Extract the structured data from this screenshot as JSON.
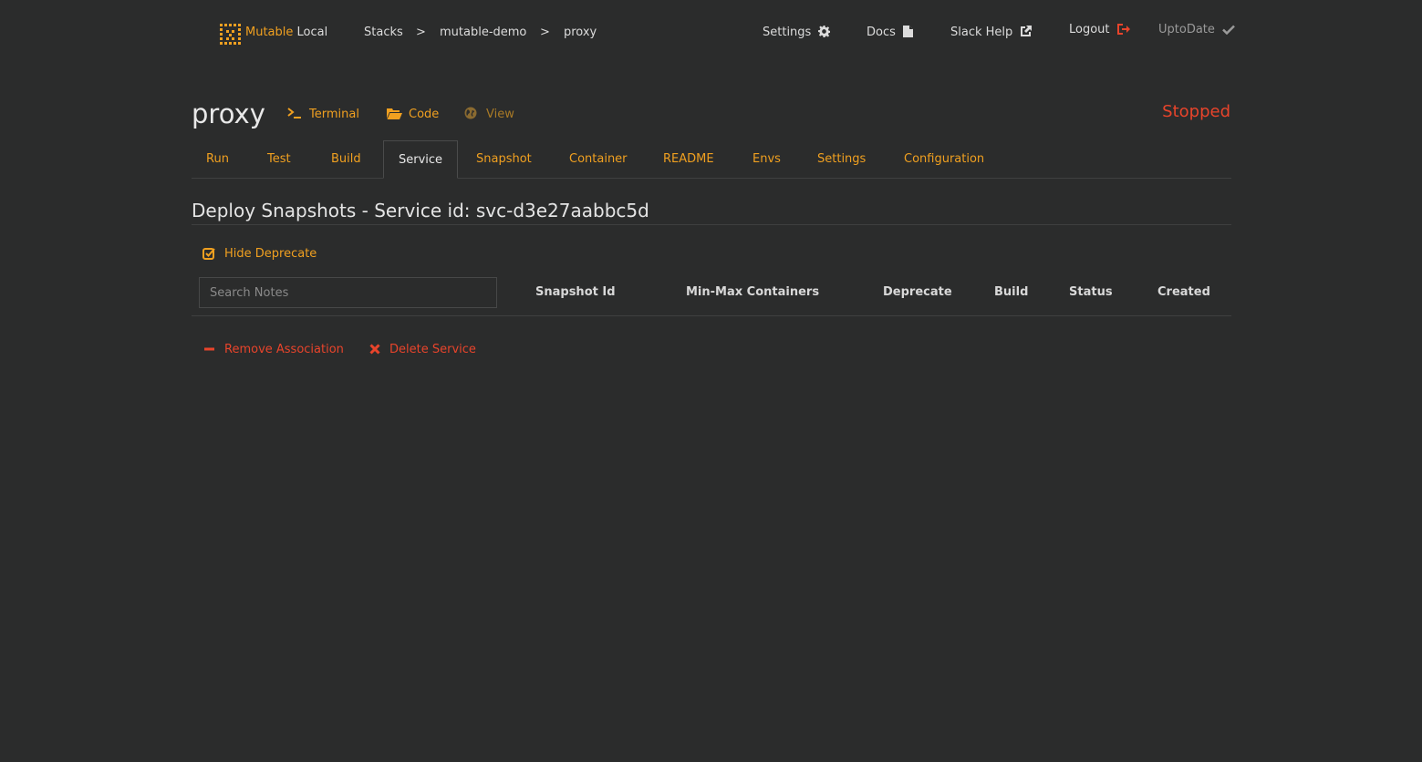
{
  "nav": {
    "brand_accent": "Mutable",
    "brand_rest": " Local",
    "breadcrumb": [
      "Stacks",
      "mutable-demo",
      "proxy"
    ],
    "separator": ">",
    "settings": "Settings",
    "docs": "Docs",
    "slack_help": "Slack Help",
    "logout": "Logout",
    "status": "UptoDate"
  },
  "header": {
    "title": "proxy",
    "actions": {
      "terminal": "Terminal",
      "code": "Code",
      "view": "View"
    },
    "state": "Stopped"
  },
  "tabs": [
    {
      "label": "Run"
    },
    {
      "label": "Test"
    },
    {
      "label": "Build"
    },
    {
      "label": "Service"
    },
    {
      "label": "Snapshot"
    },
    {
      "label": "Container"
    },
    {
      "label": "README"
    },
    {
      "label": "Envs"
    },
    {
      "label": "Settings"
    },
    {
      "label": "Configuration"
    }
  ],
  "active_tab": "Service",
  "section": {
    "title": "Deploy Snapshots - Service id: svc-d3e27aabbc5d",
    "hide_deprecate": "Hide Deprecate",
    "search_placeholder": "Search Notes",
    "columns": [
      "Snapshot Id",
      "Min-Max Containers",
      "Deprecate",
      "Build",
      "Status",
      "Created"
    ]
  },
  "footer_actions": {
    "remove_association": "Remove Association",
    "delete_service": "Delete Service"
  },
  "colors": {
    "accent": "#f0a020",
    "danger": "#e8442b",
    "background": "#2b2c2c"
  }
}
